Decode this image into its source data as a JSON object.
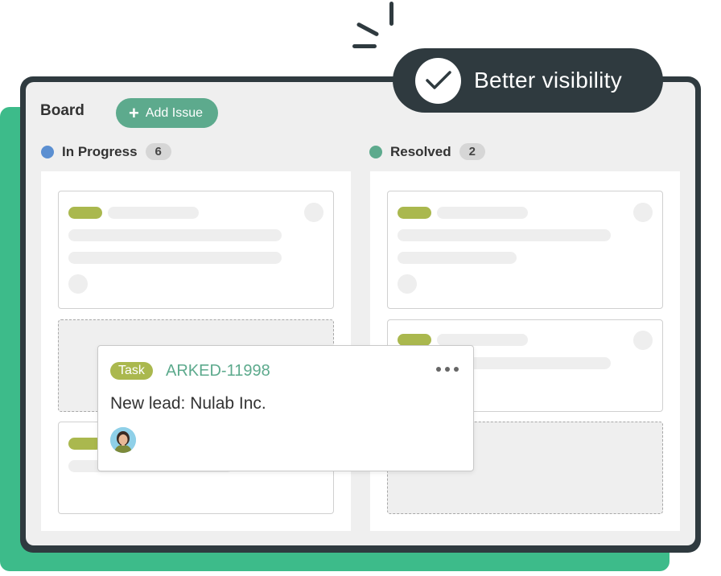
{
  "callout": {
    "text": "Better visibility",
    "icon": "check-icon"
  },
  "board": {
    "title": "Board",
    "add_issue_label": "Add Issue",
    "add_issue_icon": "plus-icon"
  },
  "columns": [
    {
      "name": "In Progress",
      "count": "6",
      "color": "#5b8fd1"
    },
    {
      "name": "Resolved",
      "count": "2",
      "color": "#5daa8d"
    }
  ],
  "task_card": {
    "type": "Task",
    "key": "ARKED-11998",
    "summary": "New lead: Nulab Inc.",
    "menu_icon": "more-horizontal-icon",
    "assignee_icon": "avatar"
  },
  "colors": {
    "accent_green": "#3dbb8a",
    "dark": "#2f3a3f",
    "button_green": "#5daa8d",
    "task_badge": "#aab84e"
  }
}
